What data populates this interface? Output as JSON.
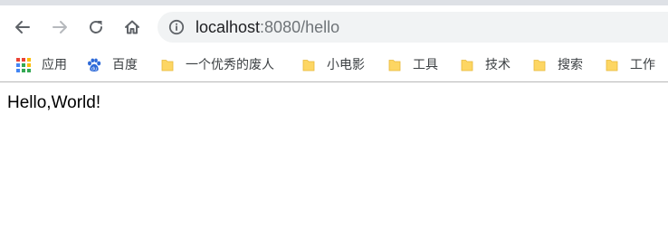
{
  "browser": {
    "address_bar": {
      "host": "localhost",
      "path": ":8080/hello"
    },
    "nav": {
      "back_icon": "arrow-left-icon",
      "forward_icon": "arrow-right-icon",
      "reload_icon": "reload-icon",
      "home_icon": "home-icon",
      "info_icon": "info-icon"
    },
    "bookmarks": [
      {
        "label": "应用",
        "icon": "apps-grid-icon"
      },
      {
        "label": "百度",
        "icon": "baidu-paw-icon"
      },
      {
        "label": "一个优秀的废人",
        "icon": "folder-icon"
      },
      {
        "label": "小电影",
        "icon": "folder-icon"
      },
      {
        "label": "工具",
        "icon": "folder-icon"
      },
      {
        "label": "技术",
        "icon": "folder-icon"
      },
      {
        "label": "搜索",
        "icon": "folder-icon"
      },
      {
        "label": "工作",
        "icon": "folder-icon"
      }
    ]
  },
  "page": {
    "body_text": "Hello,World!"
  },
  "colors": {
    "accent_disabled": "#b6b9bd",
    "icon_gray": "#5f6368",
    "folder_yellow": "#fdd663",
    "omnibox_bg": "#f1f3f4"
  }
}
